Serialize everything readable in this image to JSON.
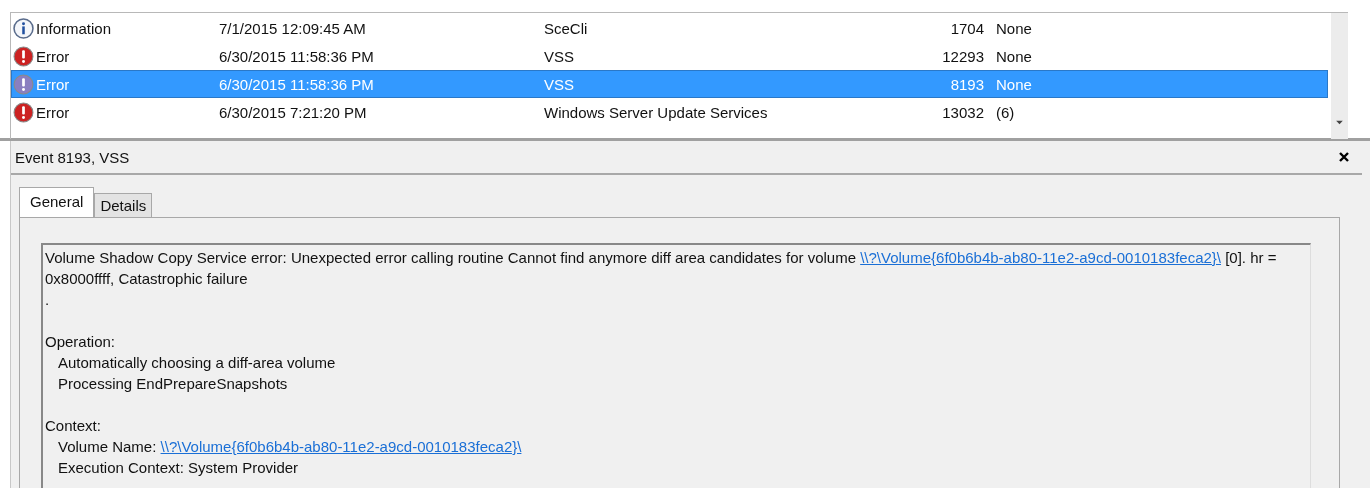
{
  "events": [
    {
      "kind": "info",
      "level": "Information",
      "date": "7/1/2015 12:09:45 AM",
      "source": "SceCli",
      "event_id": "1704",
      "task_category": "None",
      "selected": false
    },
    {
      "kind": "error",
      "level": "Error",
      "date": "6/30/2015 11:58:36 PM",
      "source": "VSS",
      "event_id": "12293",
      "task_category": "None",
      "selected": false
    },
    {
      "kind": "error",
      "level": "Error",
      "date": "6/30/2015 11:58:36 PM",
      "source": "VSS",
      "event_id": "8193",
      "task_category": "None",
      "selected": true
    },
    {
      "kind": "error",
      "level": "Error",
      "date": "6/30/2015 7:21:20 PM",
      "source": "Windows Server Update Services",
      "event_id": "13032",
      "task_category": "(6)",
      "selected": false
    }
  ],
  "detail": {
    "title": "Event 8193, VSS",
    "tabs": [
      {
        "label": "General",
        "selected": true
      },
      {
        "label": "Details",
        "selected": false
      }
    ],
    "message": {
      "text": "Volume Shadow Copy Service error: Unexpected error calling routine Cannot find anymore diff area candidates for volume",
      "link": "\\\\?\\Volume{6f0b6b4b-ab80-11e2-a9cd-0010183feca2}\\",
      "text_after": "[0].  hr = 0x8000ffff, Catastrophic failure"
    },
    "trailing_dot": ".",
    "operation": {
      "heading": "Operation:",
      "items": [
        "Automatically choosing a diff-area volume",
        "Processing EndPrepareSnapshots"
      ]
    },
    "context": {
      "heading": "Context:",
      "volume_name_label": "Volume Name:",
      "volume_name_link": "\\\\?\\Volume{6f0b6b4b-ab80-11e2-a9cd-0010183feca2}\\",
      "execution_context": "Execution Context: System Provider"
    }
  }
}
